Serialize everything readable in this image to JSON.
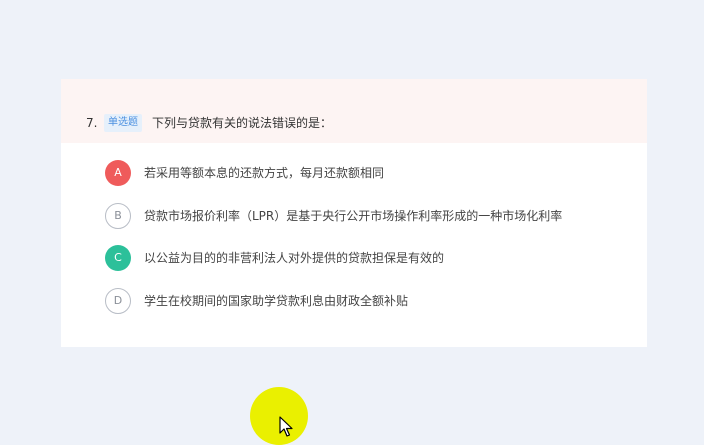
{
  "question": {
    "number": "7.",
    "type_label": "单选题",
    "text": "下列与贷款有关的说法错误的是："
  },
  "options": [
    {
      "letter": "A",
      "text": "若采用等额本息的还款方式，每月还款额相同",
      "state": "wrong"
    },
    {
      "letter": "B",
      "text": "贷款市场报价利率（LPR）是基于央行公开市场操作利率形成的一种市场化利率",
      "state": "plain"
    },
    {
      "letter": "C",
      "text": "以公益为目的的非营利法人对外提供的贷款担保是有效的",
      "state": "right"
    },
    {
      "letter": "D",
      "text": "学生在校期间的国家助学贷款利息由财政全额补贴",
      "state": "plain"
    }
  ],
  "colors": {
    "background": "#eef2f9",
    "header_background": "#fdf4f3",
    "wrong": "#ef5b5b",
    "right": "#2cc09a",
    "type_badge": "#4a8fe0",
    "cursor_highlight": "#eaf000"
  },
  "icons": {
    "cursor": "mouse-pointer-icon"
  }
}
